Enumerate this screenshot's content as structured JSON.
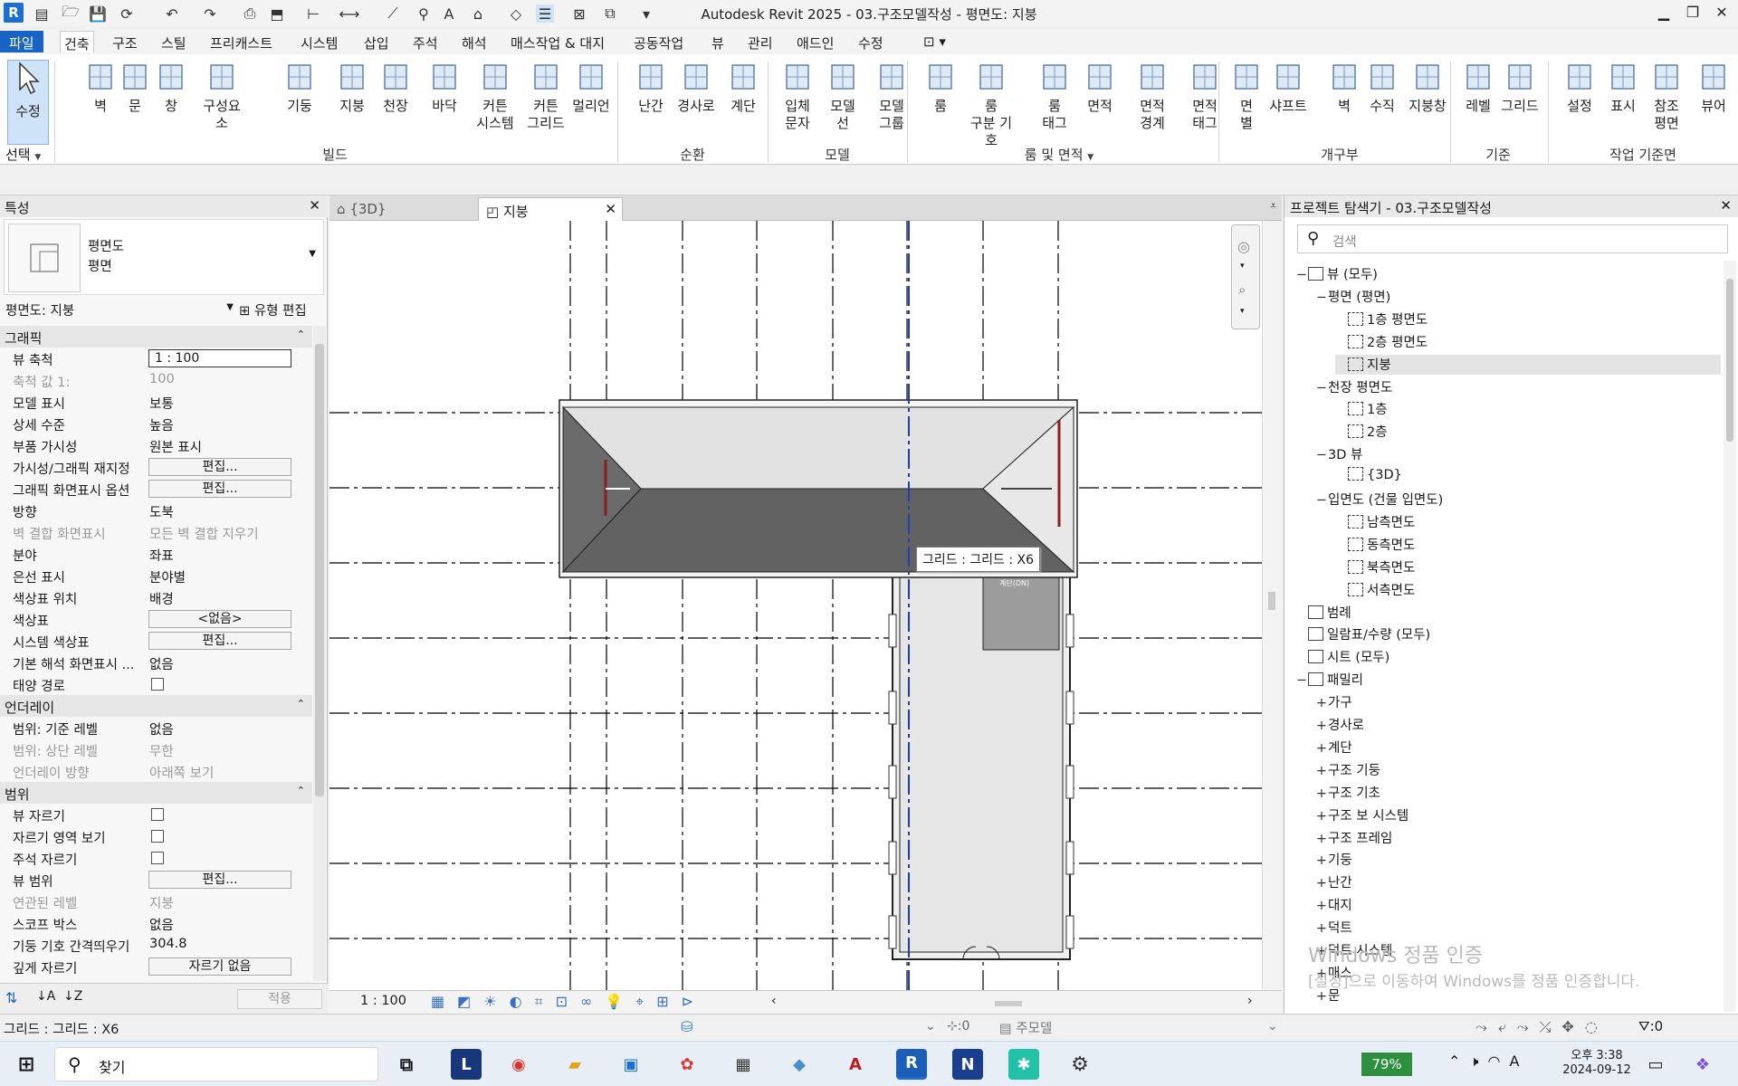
{
  "window": {
    "title": "Autodesk Revit 2025 - 03.구조모델작성 - 평면도: 지붕",
    "minimize": "▁",
    "maximize": "❐",
    "close": "✕"
  },
  "ribbon_tabs": [
    "파일",
    "건축",
    "구조",
    "스틸",
    "프리캐스트",
    "시스템",
    "삽입",
    "주석",
    "해석",
    "매스작업 & 대지",
    "공동작업",
    "뷰",
    "관리",
    "애드인",
    "수정"
  ],
  "ribbon": {
    "modify": "수정",
    "select": "선택",
    "buttons": [
      {
        "label": "벽",
        "icon": "wall-icon"
      },
      {
        "label": "문",
        "icon": "door-icon"
      },
      {
        "label": "창",
        "icon": "window-icon"
      },
      {
        "label": "구성요소",
        "icon": "component-icon"
      },
      {
        "label": "기둥",
        "icon": "column-icon"
      },
      {
        "label": "지붕",
        "icon": "roof-icon"
      },
      {
        "label": "천장",
        "icon": "ceiling-icon"
      },
      {
        "label": "바닥",
        "icon": "floor-icon"
      },
      {
        "label": "커튼\n시스템",
        "icon": "curtain-system-icon"
      },
      {
        "label": "커튼\n그리드",
        "icon": "curtain-grid-icon"
      },
      {
        "label": "멀리언",
        "icon": "mullion-icon"
      },
      {
        "label": "난간",
        "icon": "railing-icon"
      },
      {
        "label": "경사로",
        "icon": "ramp-icon"
      },
      {
        "label": "계단",
        "icon": "stair-icon"
      },
      {
        "label": "입체\n문자",
        "icon": "model-text-icon"
      },
      {
        "label": "모델\n선",
        "icon": "model-line-icon"
      },
      {
        "label": "모델\n그룹",
        "icon": "model-group-icon"
      },
      {
        "label": "룸",
        "icon": "room-icon"
      },
      {
        "label": "룸\n구분 기호",
        "icon": "room-separator-icon"
      },
      {
        "label": "룸\n태그",
        "icon": "room-tag-icon"
      },
      {
        "label": "면적",
        "icon": "area-icon"
      },
      {
        "label": "면적\n경계",
        "icon": "area-boundary-icon"
      },
      {
        "label": "면적\n태그",
        "icon": "area-tag-icon"
      },
      {
        "label": "면\n별",
        "icon": "by-face-icon"
      },
      {
        "label": "샤프트",
        "icon": "shaft-icon"
      },
      {
        "label": "벽",
        "icon": "wall-opening-icon"
      },
      {
        "label": "수직",
        "icon": "vertical-opening-icon"
      },
      {
        "label": "지붕창",
        "icon": "dormer-icon"
      },
      {
        "label": "레벨",
        "icon": "level-icon"
      },
      {
        "label": "그리드",
        "icon": "grid-icon"
      },
      {
        "label": "설정",
        "icon": "set-workplane-icon"
      },
      {
        "label": "표시",
        "icon": "show-workplane-icon"
      },
      {
        "label": "참조\n평면",
        "icon": "ref-plane-icon"
      },
      {
        "label": "뷰어",
        "icon": "viewer-icon"
      }
    ],
    "panels": [
      "빌드",
      "순환",
      "모델",
      "룸 및 면적",
      "개구부",
      "기준",
      "작업 기준면"
    ]
  },
  "properties": {
    "title": "특성",
    "type_name1": "평면도",
    "type_name2": "평면",
    "instance": "평면도: 지붕",
    "edit_type": "유형 편집",
    "sections": {
      "graphics": "그래픽",
      "underlay": "언더레이",
      "extents": "범위"
    },
    "rows": [
      {
        "k": "뷰 축척",
        "v": "1 : 100",
        "kind": "input"
      },
      {
        "k": "축척 값    1:",
        "v": "100",
        "kind": "dim"
      },
      {
        "k": "모델 표시",
        "v": "보통",
        "kind": "text"
      },
      {
        "k": "상세 수준",
        "v": "높음",
        "kind": "text"
      },
      {
        "k": "부품 가시성",
        "v": "원본 표시",
        "kind": "text"
      },
      {
        "k": "가시성/그래픽 재지정",
        "v": "편집...",
        "kind": "button"
      },
      {
        "k": "그래픽 화면표시 옵션",
        "v": "편집...",
        "kind": "button"
      },
      {
        "k": "방향",
        "v": "도북",
        "kind": "text"
      },
      {
        "k": "벽 결합 화면표시",
        "v": "모든 벽 결합 지우기",
        "kind": "dim"
      },
      {
        "k": "분야",
        "v": "좌표",
        "kind": "text"
      },
      {
        "k": "은선 표시",
        "v": "분야별",
        "kind": "text"
      },
      {
        "k": "색상표 위치",
        "v": "배경",
        "kind": "text"
      },
      {
        "k": "색상표",
        "v": "<없음>",
        "kind": "button"
      },
      {
        "k": "시스템 색상표",
        "v": "편집...",
        "kind": "button"
      },
      {
        "k": "기본 해석 화면표시 ...",
        "v": "없음",
        "kind": "text"
      },
      {
        "k": "태양 경로",
        "v": "",
        "kind": "check"
      }
    ],
    "underlay_rows": [
      {
        "k": "범위: 기준 레벨",
        "v": "없음",
        "kind": "text"
      },
      {
        "k": "범위: 상단 레벨",
        "v": "무한",
        "kind": "dim"
      },
      {
        "k": "언더레이 방향",
        "v": "아래쪽 보기",
        "kind": "dim"
      }
    ],
    "extent_rows": [
      {
        "k": "뷰 자르기",
        "v": "",
        "kind": "check"
      },
      {
        "k": "자르기 영역 보기",
        "v": "",
        "kind": "check"
      },
      {
        "k": "주석 자르기",
        "v": "",
        "kind": "check"
      },
      {
        "k": "뷰 범위",
        "v": "편집...",
        "kind": "button"
      },
      {
        "k": "연관된 레벨",
        "v": "지붕",
        "kind": "dim"
      },
      {
        "k": "스코프 박스",
        "v": "없음",
        "kind": "text"
      },
      {
        "k": "기둥 기호 간격띄우기",
        "v": "304.8",
        "kind": "text"
      },
      {
        "k": "깊게 자르기",
        "v": "자르기 없음",
        "kind": "button"
      }
    ],
    "apply": "적용"
  },
  "view_tabs": [
    {
      "label": "{3D}"
    },
    {
      "label": "지붕"
    }
  ],
  "canvas": {
    "tooltip": "그리드 : 그리드 : X6",
    "stair_tag": "계단(DN)"
  },
  "view_bar": {
    "scale": "1 : 100"
  },
  "browser": {
    "title": "프로젝트 탐색기 - 03.구조모델작성",
    "search_placeholder": "검색",
    "nodes": [
      {
        "t": "뷰 (모두)",
        "lvl": 0,
        "pm": "−",
        "ico": "views"
      },
      {
        "t": "평면 (평면)",
        "lvl": 1,
        "pm": "−"
      },
      {
        "t": "1층 평면도",
        "lvl": 2,
        "ico": "view"
      },
      {
        "t": "2층 평면도",
        "lvl": 2,
        "ico": "view"
      },
      {
        "t": "지붕",
        "lvl": 2,
        "ico": "view",
        "sel": true
      },
      {
        "t": "천장 평면도",
        "lvl": 1,
        "pm": "−"
      },
      {
        "t": "1층",
        "lvl": 2,
        "ico": "view"
      },
      {
        "t": "2층",
        "lvl": 2,
        "ico": "view"
      },
      {
        "t": "3D 뷰",
        "lvl": 1,
        "pm": "−"
      },
      {
        "t": "{3D}",
        "lvl": 2,
        "ico": "view"
      },
      {
        "t": "입면도 (건물 입면도)",
        "lvl": 1,
        "pm": "−"
      },
      {
        "t": "남측면도",
        "lvl": 2,
        "ico": "view"
      },
      {
        "t": "동측면도",
        "lvl": 2,
        "ico": "view"
      },
      {
        "t": "북측면도",
        "lvl": 2,
        "ico": "view"
      },
      {
        "t": "서측면도",
        "lvl": 2,
        "ico": "view"
      },
      {
        "t": "범례",
        "lvl": 0,
        "ico": "legend"
      },
      {
        "t": "일람표/수량 (모두)",
        "lvl": 0,
        "ico": "schedule"
      },
      {
        "t": "시트 (모두)",
        "lvl": 0,
        "ico": "sheet"
      },
      {
        "t": "패밀리",
        "lvl": 0,
        "pm": "−",
        "ico": "family"
      },
      {
        "t": "가구",
        "lvl": 1,
        "pm": "+"
      },
      {
        "t": "경사로",
        "lvl": 1,
        "pm": "+"
      },
      {
        "t": "계단",
        "lvl": 1,
        "pm": "+"
      },
      {
        "t": "구조 기둥",
        "lvl": 1,
        "pm": "+"
      },
      {
        "t": "구조 기초",
        "lvl": 1,
        "pm": "+"
      },
      {
        "t": "구조 보 시스템",
        "lvl": 1,
        "pm": "+"
      },
      {
        "t": "구조 프레임",
        "lvl": 1,
        "pm": "+"
      },
      {
        "t": "기둥",
        "lvl": 1,
        "pm": "+"
      },
      {
        "t": "난간",
        "lvl": 1,
        "pm": "+"
      },
      {
        "t": "대지",
        "lvl": 1,
        "pm": "+"
      },
      {
        "t": "덕트",
        "lvl": 1,
        "pm": "+"
      },
      {
        "t": "덕트 시스템",
        "lvl": 1,
        "pm": "+"
      },
      {
        "t": "매스",
        "lvl": 1,
        "pm": "+"
      },
      {
        "t": "문",
        "lvl": 1,
        "pm": "+"
      }
    ]
  },
  "watermark": {
    "line1": "Windows 정품 인증",
    "line2": "[설정]으로 이동하여 Windows를 정품 인증합니다."
  },
  "status": {
    "left": "그리드 : 그리드 : X6",
    "count": ":0",
    "main_model": "주모델",
    "filter": ":0"
  },
  "taskbar": {
    "search": "찾기",
    "battery": "79%",
    "time": "오후 3:38",
    "date": "2024-09-12"
  }
}
